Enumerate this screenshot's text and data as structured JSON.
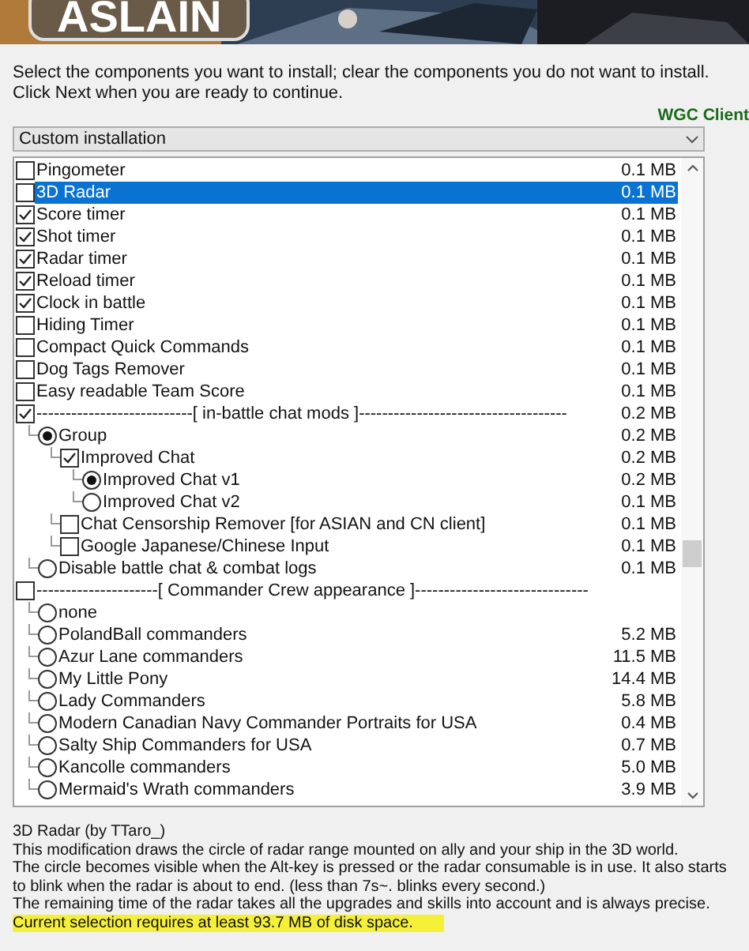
{
  "banner": {
    "logo": "ASLAIN"
  },
  "instructions": "Select the components you want to install; clear the components you do not want to install. Click Next when you are ready to continue.",
  "client_label": "WGC Client",
  "install_type": {
    "value": "Custom installation"
  },
  "components": [
    {
      "label": "Pingometer",
      "size": "0.1 MB",
      "kind": "checkbox",
      "checked": false,
      "selected": false
    },
    {
      "label": "3D Radar",
      "size": "0.1 MB",
      "kind": "checkbox",
      "checked": false,
      "selected": true
    },
    {
      "label": "Score timer",
      "size": "0.1 MB",
      "kind": "checkbox",
      "checked": true,
      "selected": false
    },
    {
      "label": "Shot timer",
      "size": "0.1 MB",
      "kind": "checkbox",
      "checked": true,
      "selected": false
    },
    {
      "label": "Radar timer",
      "size": "0.1 MB",
      "kind": "checkbox",
      "checked": true,
      "selected": false
    },
    {
      "label": "Reload timer",
      "size": "0.1 MB",
      "kind": "checkbox",
      "checked": true,
      "selected": false
    },
    {
      "label": "Clock in battle",
      "size": "0.1 MB",
      "kind": "checkbox",
      "checked": true,
      "selected": false
    },
    {
      "label": "Hiding Timer",
      "size": "0.1 MB",
      "kind": "checkbox",
      "checked": false,
      "selected": false
    },
    {
      "label": "Compact Quick Commands",
      "size": "0.1 MB",
      "kind": "checkbox",
      "checked": false,
      "selected": false
    },
    {
      "label": "Dog Tags Remover",
      "size": "0.1 MB",
      "kind": "checkbox",
      "checked": false,
      "selected": false
    },
    {
      "label": "Easy readable Team Score",
      "size": "0.1 MB",
      "kind": "checkbox",
      "checked": false,
      "selected": false
    },
    {
      "label": "---------------------------[ in-battle chat mods ]------------------------------------",
      "size": "0.2 MB",
      "kind": "checkbox",
      "checked": true,
      "selected": false,
      "children": [
        {
          "label": "Group",
          "size": "0.2 MB",
          "kind": "radio",
          "checked": true,
          "selected": false,
          "children": [
            {
              "label": "Improved Chat",
              "size": "0.2 MB",
              "kind": "checkbox",
              "checked": true,
              "selected": false,
              "children": [
                {
                  "label": "Improved Chat v1",
                  "size": "0.2 MB",
                  "kind": "radio",
                  "checked": true,
                  "selected": false
                },
                {
                  "label": "Improved Chat v2",
                  "size": "0.1 MB",
                  "kind": "radio",
                  "checked": false,
                  "selected": false
                }
              ]
            },
            {
              "label": "Chat Censorship Remover [for ASIAN and CN client]",
              "size": "0.1 MB",
              "kind": "checkbox",
              "checked": false,
              "selected": false
            },
            {
              "label": "Google Japanese/Chinese Input",
              "size": "0.1 MB",
              "kind": "checkbox",
              "checked": false,
              "selected": false
            }
          ]
        },
        {
          "label": "Disable battle chat & combat logs",
          "size": "0.1 MB",
          "kind": "radio",
          "checked": false,
          "selected": false
        }
      ]
    },
    {
      "label": "---------------------[ Commander Crew appearance ]------------------------------",
      "kind": "checkbox",
      "checked": false,
      "selected": false,
      "children": [
        {
          "label": "none",
          "kind": "radio",
          "checked": false,
          "selected": false
        },
        {
          "label": "PolandBall commanders",
          "size": "5.2 MB",
          "kind": "radio",
          "checked": false,
          "selected": false
        },
        {
          "label": "Azur Lane commanders",
          "size": "11.5 MB",
          "kind": "radio",
          "checked": false,
          "selected": false
        },
        {
          "label": "My Little Pony",
          "size": "14.4 MB",
          "kind": "radio",
          "checked": false,
          "selected": false
        },
        {
          "label": "Lady Commanders",
          "size": "5.8 MB",
          "kind": "radio",
          "checked": false,
          "selected": false
        },
        {
          "label": "Modern Canadian Navy Commander Portraits for USA",
          "size": "0.4 MB",
          "kind": "radio",
          "checked": false,
          "selected": false
        },
        {
          "label": "Salty Ship Commanders for USA",
          "size": "0.7 MB",
          "kind": "radio",
          "checked": false,
          "selected": false
        },
        {
          "label": "Kancolle commanders",
          "size": "5.0 MB",
          "kind": "radio",
          "checked": false,
          "selected": false
        },
        {
          "label": "Mermaid's Wrath commanders",
          "size": "3.9 MB",
          "kind": "radio",
          "checked": false,
          "selected": false
        }
      ]
    }
  ],
  "description": {
    "title": "3D Radar (by TTaro_)",
    "lines": [
      "This modification draws the circle of radar range mounted on ally and your ship in the 3D world.",
      "The circle becomes visible when the Alt-key is pressed or the radar consumable is in use. It also starts to blink when the radar is about to end. (less than 7s~. blinks every second.)",
      "The remaining time of the radar takes all the upgrades and skills into account and is always precise."
    ]
  },
  "disk_space": "Current selection requires at least 93.7 MB of disk space."
}
